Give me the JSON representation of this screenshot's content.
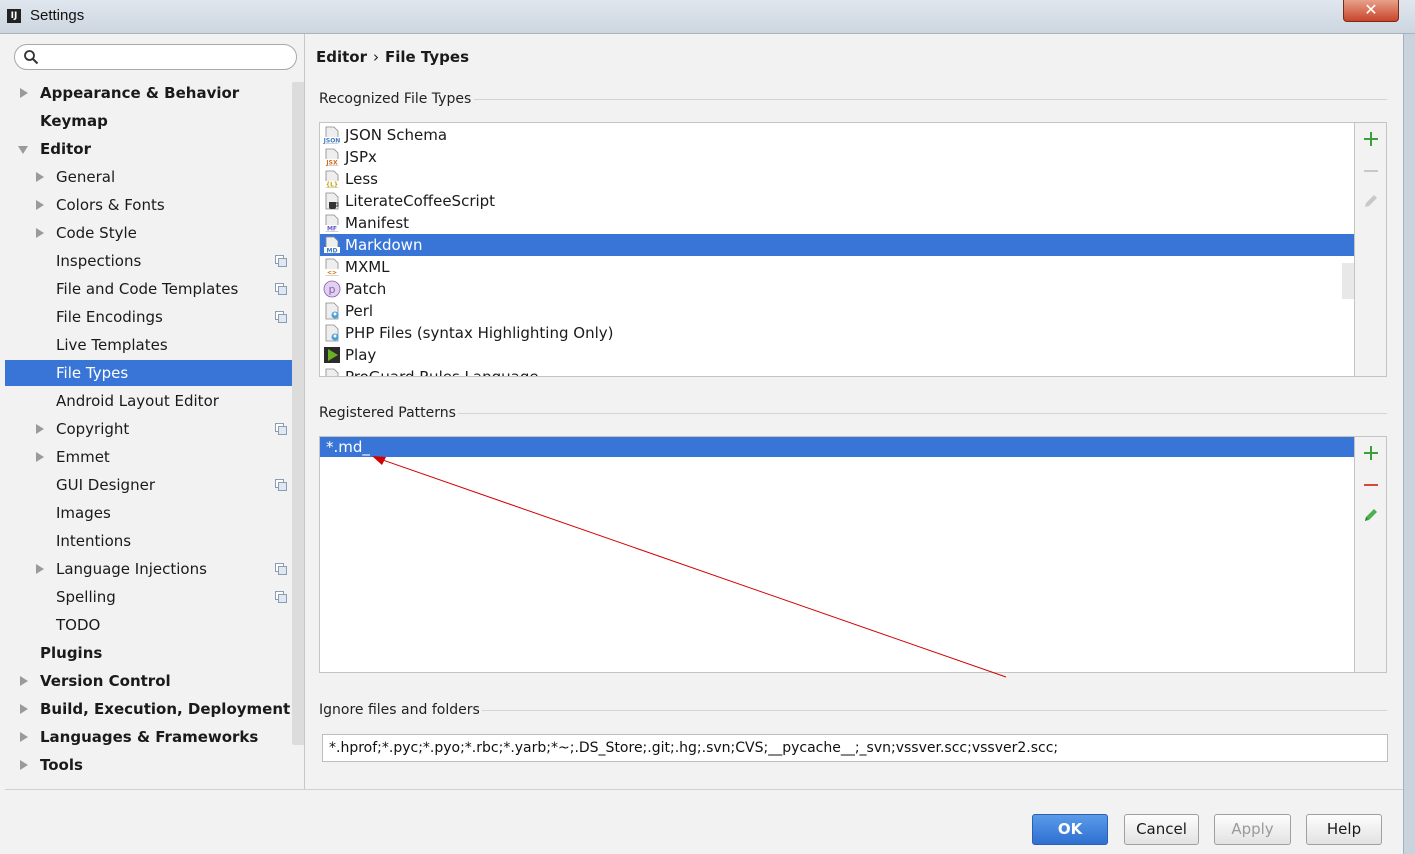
{
  "window": {
    "title": "Settings",
    "close_symbol": "✕"
  },
  "sidebar": {
    "search_placeholder": "",
    "items": [
      {
        "label": "Appearance & Behavior"
      },
      {
        "label": "Keymap"
      },
      {
        "label": "Editor"
      },
      {
        "label": "General"
      },
      {
        "label": "Colors & Fonts"
      },
      {
        "label": "Code Style"
      },
      {
        "label": "Inspections"
      },
      {
        "label": "File and Code Templates"
      },
      {
        "label": "File Encodings"
      },
      {
        "label": "Live Templates"
      },
      {
        "label": "File Types"
      },
      {
        "label": "Android Layout Editor"
      },
      {
        "label": "Copyright"
      },
      {
        "label": "Emmet"
      },
      {
        "label": "GUI Designer"
      },
      {
        "label": "Images"
      },
      {
        "label": "Intentions"
      },
      {
        "label": "Language Injections"
      },
      {
        "label": "Spelling"
      },
      {
        "label": "TODO"
      },
      {
        "label": "Plugins"
      },
      {
        "label": "Version Control"
      },
      {
        "label": "Build, Execution, Deployment"
      },
      {
        "label": "Languages & Frameworks"
      },
      {
        "label": "Tools"
      }
    ]
  },
  "main": {
    "breadcrumb": {
      "parent": "Editor",
      "separator": "›",
      "current": "File Types"
    },
    "recognized": {
      "title": "Recognized File Types",
      "items": [
        {
          "label": "JSON Schema",
          "icon": "json-file-icon",
          "badge": "JSON",
          "color": "#3d7fc0"
        },
        {
          "label": "JSPx",
          "icon": "jsx-file-icon",
          "badge": "JSX",
          "color": "#d2691e"
        },
        {
          "label": "Less",
          "icon": "less-file-icon",
          "badge": "{L}",
          "color": "#c8a000"
        },
        {
          "label": "LiterateCoffeeScript",
          "icon": "coffee-file-icon",
          "badge": "",
          "color": "#555555"
        },
        {
          "label": "Manifest",
          "icon": "manifest-file-icon",
          "badge": "MF",
          "color": "#6a5acd"
        },
        {
          "label": "Markdown",
          "icon": "markdown-file-icon",
          "badge": "MD",
          "color": "#3d7fc0"
        },
        {
          "label": "MXML",
          "icon": "mxml-file-icon",
          "badge": "<>",
          "color": "#e07000"
        },
        {
          "label": "Patch",
          "icon": "patch-file-icon",
          "badge": "p",
          "color": "#8a5fb0"
        },
        {
          "label": "Perl",
          "icon": "perl-file-icon",
          "badge": "",
          "color": "#4aa0d8"
        },
        {
          "label": "PHP Files (syntax Highlighting Only)",
          "icon": "php-file-icon",
          "badge": "",
          "color": "#4aa0d8"
        },
        {
          "label": "Play",
          "icon": "play-file-icon",
          "badge": "",
          "color": "#6ab023"
        },
        {
          "label": "ProGuard Rules Language",
          "icon": "proguard-file-icon",
          "badge": "",
          "color": "#888888"
        }
      ]
    },
    "patterns": {
      "title": "Registered Patterns",
      "items": [
        {
          "label": "*.md_"
        }
      ]
    },
    "ignore": {
      "title": "Ignore files and folders",
      "value": "*.hprof;*.pyc;*.pyo;*.rbc;*.yarb;*~;.DS_Store;.git;.hg;.svn;CVS;__pycache__;_svn;vssver.scc;vssver2.scc;"
    }
  },
  "buttons": {
    "ok": "OK",
    "cancel": "Cancel",
    "apply": "Apply",
    "help": "Help"
  },
  "colors": {
    "selection": "#3875d7",
    "add_green": "#3c9f3c",
    "remove_red": "#d24b3a",
    "annotation_arrow": "#d40000"
  }
}
